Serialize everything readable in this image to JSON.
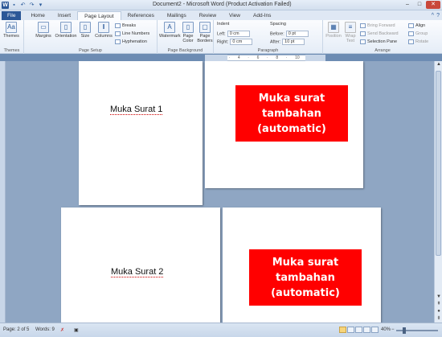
{
  "window": {
    "title": "Document2 - Microsoft Word (Product Activation Failed)",
    "controls": {
      "minimize": "–",
      "maximize": "□",
      "close": "✕"
    }
  },
  "qat": {
    "logo": "W",
    "save": "▪",
    "undo": "↶",
    "redo": "↷",
    "more": "▾"
  },
  "tabs": [
    {
      "label": "File"
    },
    {
      "label": "Home"
    },
    {
      "label": "Insert"
    },
    {
      "label": "Page Layout"
    },
    {
      "label": "References"
    },
    {
      "label": "Mailings"
    },
    {
      "label": "Review"
    },
    {
      "label": "View"
    },
    {
      "label": "Add-Ins"
    }
  ],
  "ribbon": {
    "themes": {
      "label": "Themes",
      "group": "Themes"
    },
    "page_setup": {
      "margins": "Margins",
      "orientation": "Orientation",
      "size": "Size",
      "columns": "Columns",
      "breaks": "Breaks",
      "line_numbers": "Line Numbers",
      "hyphenation": "Hyphenation",
      "group": "Page Setup"
    },
    "page_background": {
      "watermark": "Watermark",
      "page_color": "Page Color",
      "page_borders": "Page Borders",
      "group": "Page Background"
    },
    "paragraph": {
      "indent_title": "Indent",
      "left_label": "Left:",
      "left_value": "0 cm",
      "right_label": "Right:",
      "right_value": "0 cm",
      "spacing_title": "Spacing",
      "before_label": "Before:",
      "before_value": "0 pt",
      "after_label": "After:",
      "after_value": "10 pt",
      "group": "Paragraph"
    },
    "arrange": {
      "position": "Position",
      "wrap_text": "Wrap Text",
      "bring_forward": "Bring Forward",
      "send_backward": "Send Backward",
      "selection_pane": "Selection Pane",
      "align": "Align",
      "group_btn": "Group",
      "rotate": "Rotate",
      "group": "Arrange"
    }
  },
  "document": {
    "page1_text": "Muka Surat 1",
    "page2_text": "Muka Surat 2",
    "box1_text": "Muka surat tambahan (automatic)",
    "box2_text": "Muka surat tambahan (automatic)"
  },
  "status": {
    "page": "Page: 2 of 5",
    "words": "Words: 9",
    "zoom": "40%"
  },
  "colors": {
    "accent": "#2b5797",
    "box": "#ff0000"
  }
}
